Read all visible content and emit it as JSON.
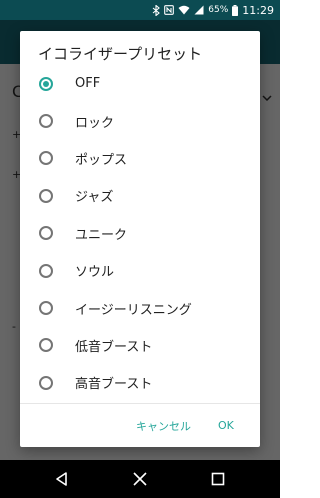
{
  "status_bar": {
    "battery": "65%",
    "time": "11:29",
    "icons": [
      "bluetooth-icon",
      "nfc-icon",
      "wifi-icon",
      "signal-icon",
      "battery-icon"
    ]
  },
  "background": {
    "visible_left_chars": [
      "C",
      "+",
      "+",
      "-"
    ]
  },
  "dialog": {
    "title": "イコライザープリセット",
    "options": [
      {
        "label": "OFF",
        "selected": true
      },
      {
        "label": "ロック",
        "selected": false
      },
      {
        "label": "ポップス",
        "selected": false
      },
      {
        "label": "ジャズ",
        "selected": false
      },
      {
        "label": "ユニーク",
        "selected": false
      },
      {
        "label": "ソウル",
        "selected": false
      },
      {
        "label": "イージーリスニング",
        "selected": false
      },
      {
        "label": "低音ブースト",
        "selected": false
      },
      {
        "label": "高音ブースト",
        "selected": false
      }
    ],
    "cancel_label": "キャンセル",
    "ok_label": "OK"
  },
  "colors": {
    "accent": "#26a69a",
    "status_bar": "#0c4b52",
    "app_bar": "#176d78"
  }
}
